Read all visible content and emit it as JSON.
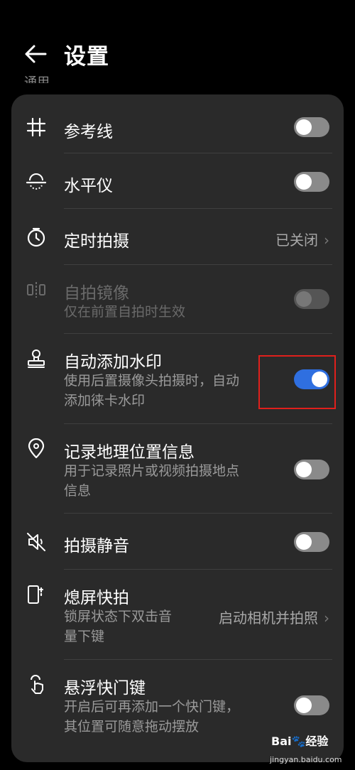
{
  "header": {
    "title": "设置",
    "section_label": "通用"
  },
  "items": [
    {
      "label": "参考线",
      "icon": "grid-icon",
      "toggle": "off"
    },
    {
      "label": "水平仪",
      "icon": "level-icon",
      "toggle": "off"
    },
    {
      "label": "定时拍摄",
      "icon": "timer-icon",
      "value": "已关闭"
    },
    {
      "label": "自拍镜像",
      "sub": [
        "仅在前置自拍时生效"
      ],
      "icon": "mirror-icon",
      "toggle": "disabled"
    },
    {
      "label": "自动添加水印",
      "sub": [
        "使用后置摄像头拍摄时，自动",
        "添加徕卡水印"
      ],
      "icon": "stamp-icon",
      "toggle": "on"
    },
    {
      "label": "记录地理位置信息",
      "sub": [
        "用于记录照片或视频拍摄地点",
        "信息"
      ],
      "icon": "location-icon",
      "toggle": "off"
    },
    {
      "label": "拍摄静音",
      "icon": "mute-icon",
      "toggle": "off"
    },
    {
      "label": "熄屏快拍",
      "sub": [
        "锁屏状态下双击音",
        "量下键"
      ],
      "icon": "quick-snap-icon",
      "value": "启动相机并拍照"
    },
    {
      "label": "悬浮快门键",
      "sub": [
        "开启后可再添加一个快门键，",
        "其位置可随意拖动摆放"
      ],
      "icon": "floating-shutter-icon",
      "toggle": "off"
    }
  ],
  "chevron": "›",
  "watermark": {
    "brand": "Bai",
    "brand_suffix": "经验",
    "url": "jingyan.baidu.com"
  },
  "colors": {
    "background": "#000000",
    "card": "#2a2a2a",
    "toggle_on": "#2f6fe0",
    "toggle_off": "#8a8a8a",
    "highlight": "#e0201c"
  }
}
